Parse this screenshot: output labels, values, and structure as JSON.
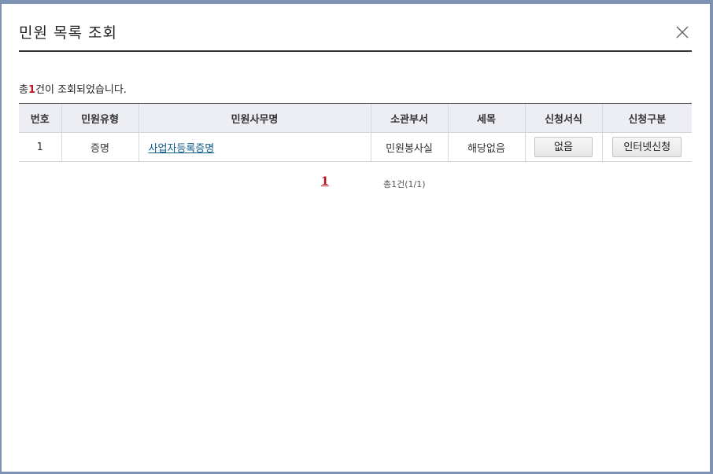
{
  "dialog": {
    "title": "민원 목록 조회",
    "close_icon": "close-icon"
  },
  "summary": {
    "prefix": "총",
    "count": "1",
    "suffix": "건이 조회되었습니다."
  },
  "table": {
    "headers": [
      "번호",
      "민원유형",
      "민원사무명",
      "소관부서",
      "세목",
      "신청서식",
      "신청구분"
    ],
    "rows": [
      {
        "no": "1",
        "type": "증명",
        "name": "사업자등록증명",
        "dept": "민원봉사실",
        "tax_item": "해당없음",
        "form_button": "없음",
        "apply_button": "인터넷신청"
      }
    ]
  },
  "pagination": {
    "current_page": "1",
    "info": "총1건(1/1)"
  },
  "colors": {
    "accent_red": "#c0141c",
    "link_blue": "#0b5b8a",
    "header_bg": "#eceef3"
  }
}
